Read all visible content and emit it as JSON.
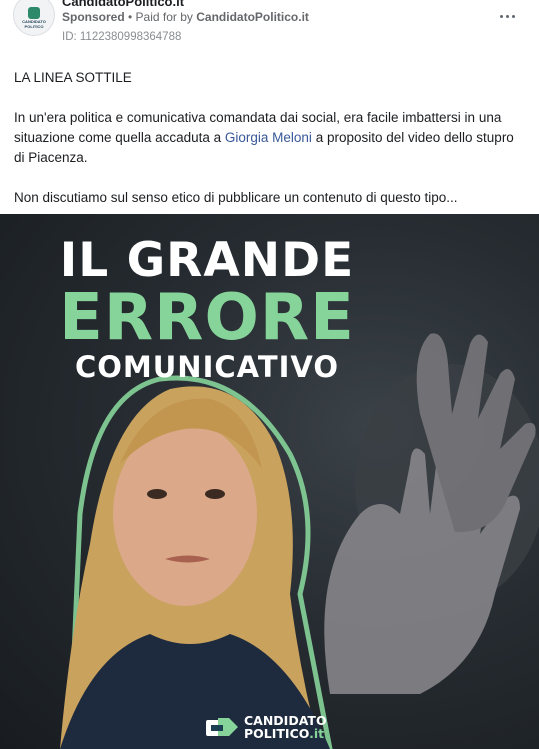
{
  "ad": {
    "page_name": "CandidatoPolitico.it",
    "sponsored": "Sponsored",
    "paid_for_prefix": " • Paid for by ",
    "paid_for_name": "CandidatoPolitico.it",
    "ad_id": "ID: 1122380998364788",
    "avatar_text": "CANDIDATO POLITICO"
  },
  "post": {
    "heading": "LA LINEA SOTTILE",
    "p2_before": "In un'era politica e comunicativa comandata dai social, era facile imbattersi in una situazione come quella accaduta a ",
    "p2_link": "Giorgia Meloni",
    "p2_after": " a proposito del video dello stupro di Piacenza.",
    "p3": "Non discutiamo sul senso etico di pubblicare un contenuto di questo tipo..."
  },
  "creative": {
    "line1": "IL GRANDE",
    "line2": "ERRORE",
    "line3": "COMUNICATIVO",
    "brand_line1": "CANDIDATO",
    "brand_line2": "POLITICO",
    "brand_tld": ".it",
    "accent_color": "#86d49a"
  },
  "icons": {
    "more": "more-horizontal-icon",
    "logo": "candidato-politico-logo-icon"
  }
}
